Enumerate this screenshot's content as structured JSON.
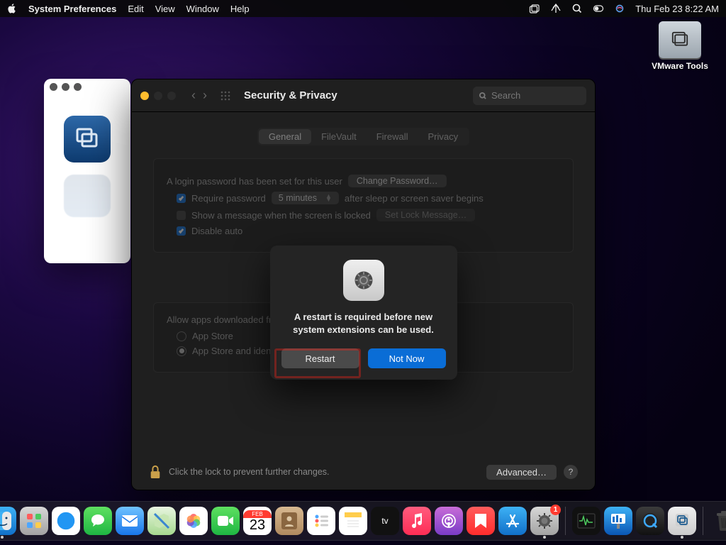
{
  "menubar": {
    "app_name": "System Preferences",
    "items": [
      "Edit",
      "View",
      "Window",
      "Help"
    ],
    "clock": "Thu Feb 23  8:22 AM"
  },
  "desktop": {
    "vmware_label": "VMware Tools"
  },
  "pref": {
    "title": "Security & Privacy",
    "search_placeholder": "Search",
    "tabs": [
      "General",
      "FileVault",
      "Firewall",
      "Privacy"
    ],
    "active_tab": 0,
    "login_pw_text": "A login password has been set for this user",
    "change_pw_btn": "Change Password…",
    "require_pw_label": "Require password",
    "require_pw_delay": "5 minutes",
    "require_pw_after": "after sleep or screen saver begins",
    "show_msg_label": "Show a message when the screen is locked",
    "set_lock_btn": "Set Lock Message…",
    "disable_auto_label": "Disable auto",
    "allow_title": "Allow apps downloaded from:",
    "radio1": "App Store",
    "radio2": "App Store and identified developers",
    "lock_text": "Click the lock to prevent further changes.",
    "advanced_btn": "Advanced…",
    "help": "?"
  },
  "dialog": {
    "message": "A restart is required before new system extensions can be used.",
    "restart_btn": "Restart",
    "notnow_btn": "Not Now"
  },
  "dock": {
    "calendar_month": "FEB",
    "calendar_day": "23",
    "sysprefs_badge": "1"
  }
}
